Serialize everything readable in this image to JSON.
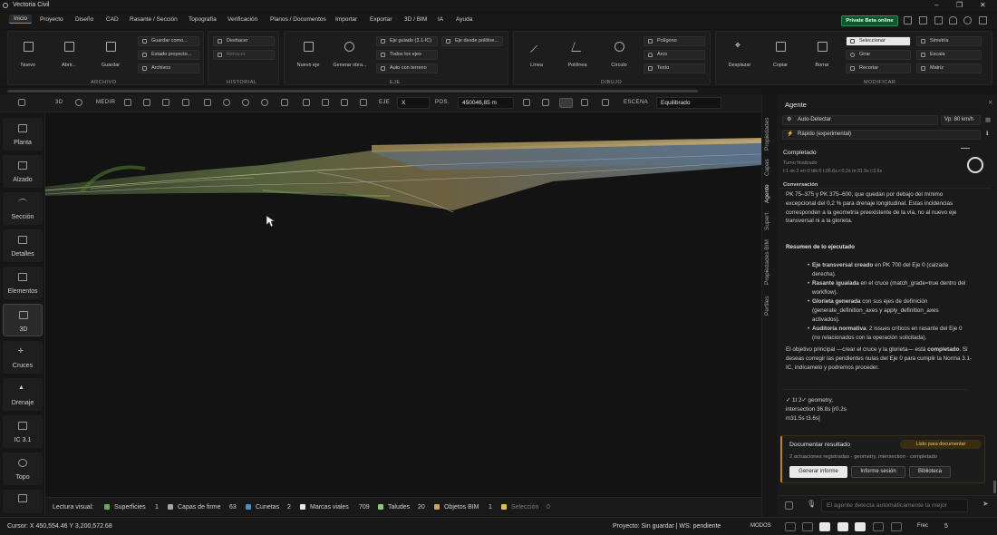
{
  "app": {
    "title": "Vectoria Civil"
  },
  "menu": {
    "items": [
      "Inicio",
      "Proyecto",
      "Diseño",
      "CAD",
      "Rasante / Sección",
      "Topografía",
      "Verificación",
      "Planos / Documentos",
      "Importar",
      "Exportar",
      "3D / BIM",
      "IA",
      "Ayuda"
    ],
    "beta_button": "Private Beta online"
  },
  "ribbon": {
    "archivo": {
      "label": "ARCHIVO",
      "nuevo": "Nuevo",
      "abrir": "Abrir...",
      "guardar": "Guardar",
      "guardar_como": "Guardar como...",
      "estado_proyecto": "Estado proyecto...",
      "archivos": "Archivos"
    },
    "historial": {
      "label": "HISTORIAL",
      "deshacer": "Deshacer",
      "rehacer": "Rehacer"
    },
    "eje": {
      "label": "EJE",
      "nuevo_eje": "Nuevo eje",
      "generar_obra": "Generar obra...",
      "eje_guiado": "Eje guiado (3.1-IC)",
      "eje_desde_polilinea": "Eje desde polilíne...",
      "todos_los_ejes": "Todos los ejes",
      "auto_con_terreno": "Auto con terreno"
    },
    "dibujo": {
      "label": "DIBUJO",
      "linea": "Línea",
      "polilinea": "Polilínea",
      "circulo": "Círculo",
      "poligono": "Polígono",
      "arco": "Arco",
      "texto": "Texto"
    },
    "modificar": {
      "label": "MODIFICAR",
      "desplazar": "Desplazar",
      "copiar": "Copiar",
      "borrar": "Borrar",
      "seleccionar": "Seleccionar",
      "simetria": "Simetría",
      "girar": "Girar",
      "escala": "Escala",
      "recortar": "Recortar",
      "matriz": "Matriz"
    }
  },
  "toolbar3d": {
    "mode_3d": "3D",
    "medir": "MEDIR",
    "eje_label": "EJE",
    "eje_value": "X",
    "pos_label": "POS.",
    "pos_value": "450046,85 m",
    "escena_label": "ESCENA",
    "escena_value": "Equilibrado"
  },
  "sidebar": {
    "items": [
      {
        "label": "Planta",
        "icon": "pen-icon"
      },
      {
        "label": "Alzado",
        "icon": "chart-icon"
      },
      {
        "label": "Sección",
        "icon": "section-icon"
      },
      {
        "label": "Detalles",
        "icon": "details-icon"
      },
      {
        "label": "Elementos",
        "icon": "elements-icon"
      },
      {
        "label": "3D",
        "icon": "cube-icon"
      },
      {
        "label": "Cruces",
        "icon": "cross-icon"
      },
      {
        "label": "Drenaje",
        "icon": "drain-icon"
      },
      {
        "label": "IC 3.1",
        "icon": "norm-icon"
      },
      {
        "label": "Topo",
        "icon": "topo-icon"
      }
    ],
    "active": "3D"
  },
  "legend": {
    "prefix": "Lectura visual:",
    "items": [
      {
        "name": "Superficies",
        "count": "1",
        "color": "#6aa84f"
      },
      {
        "name": "Capas de firme",
        "count": "63",
        "color": "#9aa7b3"
      },
      {
        "name": "Cunetas",
        "count": "2",
        "color": "#4a8fc7"
      },
      {
        "name": "Marcas viales",
        "count": "709",
        "color": "#e8e8e8"
      },
      {
        "name": "Taludes",
        "count": "20",
        "color": "#93c47d"
      },
      {
        "name": "Objetos BIM",
        "count": "1",
        "color": "#c9a35a"
      },
      {
        "name": "Selección",
        "count": "0",
        "color": "#e0c04a"
      }
    ]
  },
  "status": {
    "cursor": "Cursor: X 450,554.46  Y 3,200,572.68",
    "project": "Proyecto: Sin guardar | WS: pendiente",
    "modos": "MODOS",
    "frec_label": "Frec",
    "frec_value": "5"
  },
  "vertical_tabs": [
    "Propiedades",
    "Capas",
    "Agente",
    "Superf.",
    "Propiedades BIM",
    "Perfiles"
  ],
  "panel": {
    "title": "Agente",
    "auto_detect": "Auto-Detectar",
    "speed": "Vp: 80 km/h",
    "mode": "Rápido (experimental)",
    "status_title": "Completado",
    "status_sub": "Turno finalizado",
    "status_meta": "t:1 ok:2 err:0 blk:0 t:36.6s  r:0.2s m:31.5s t:3.6s",
    "conversation_label": "Conversación",
    "intro": "PK 75–375 y PK 375–600, que quedan por debajo del mínimo excepcional del 0,2 % para drenaje longitudinal. Estas incidencias corresponden a la geometría preexistente de la vía, no al nuevo eje transversal ni a la glorieta.",
    "summary_title": "Resumen de lo ejecutado",
    "bullets": [
      {
        "bold": "Eje transversal creado",
        "rest": " en PK 700 del Eje 0 (calzada derecha)."
      },
      {
        "bold": "Rasante igualada",
        "rest": " en el cruce (match_grade=true dentro del workflow)."
      },
      {
        "bold": "Glorieta generada",
        "rest": " con sus ejes de definición (generate_definition_axes y apply_definition_axes activados)."
      },
      {
        "bold": "Auditoría normativa",
        "rest": ": 2 issues críticos en rasante del Eje 0 (no relacionados con la operación solicitada)."
      }
    ],
    "conclusion_a": "El objetivo principal —crear el cruce y la glorieta— está ",
    "conclusion_bold": "completado",
    "conclusion_b": ". Si deseas corregir las pendientes nulas del Eje 0 para cumplir la Norma 3.1-IC, indícamelo y podremos proceder.",
    "trace_1": "✓ 1t 2✓ geometry,",
    "trace_2": "intersection 36.8s [r0.2s",
    "trace_3": "m31.5s t3.6s]",
    "doc": {
      "title": "Documentar resultado",
      "badge": "Listo para documentar",
      "meta": "2 actuaciones registradas · geometry, intersection · completado",
      "btn_informe": "Generar informe",
      "btn_sesion": "Informe sesión",
      "btn_biblioteca": "Biblioteca"
    },
    "input_placeholder": "El agente detecta automáticamente la mejor"
  },
  "colors": {
    "accent": "#4aa3df",
    "beta_bg": "#14532d",
    "doc_accent": "#b9892a"
  }
}
